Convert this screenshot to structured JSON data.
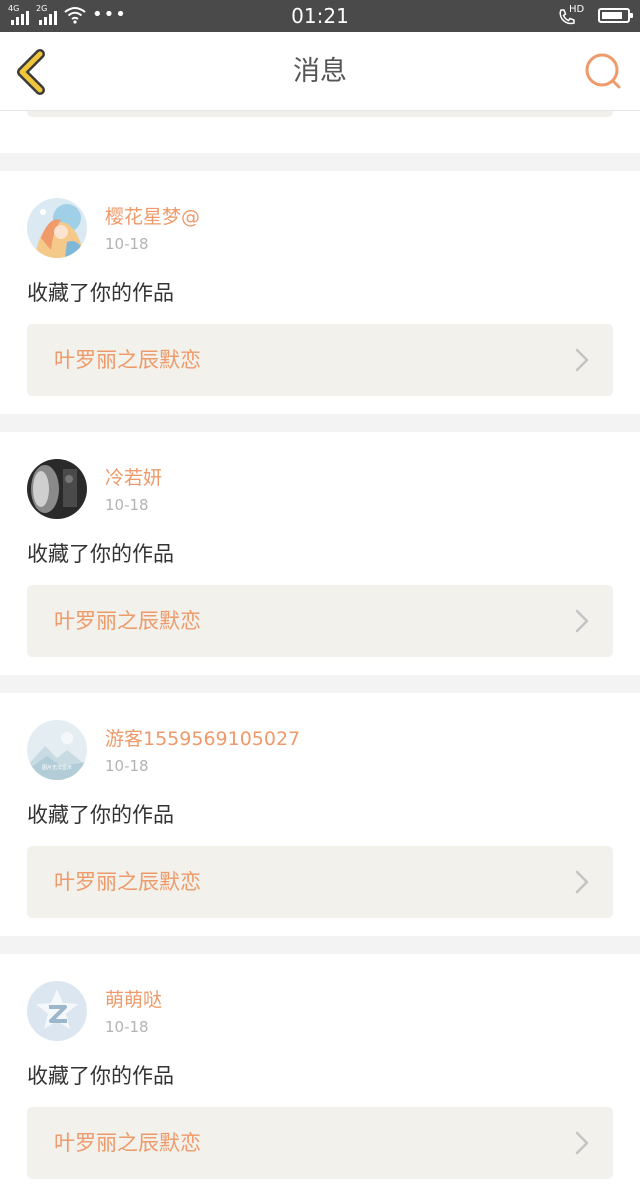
{
  "status_bar": {
    "sim1_label": "4G",
    "sim2_label": "2G",
    "time": "01:21",
    "call_label": "HD",
    "battery_level": 0.85
  },
  "header": {
    "title": "消息",
    "back_icon": "chevron-left-icon",
    "search_icon": "search-icon"
  },
  "colors": {
    "accent": "#ee9a6a",
    "back_icon": "#f0c63a",
    "card_bg": "#ffffff",
    "link_bg": "#f2f1ec",
    "page_bg": "#f3f3f3"
  },
  "messages": [
    {
      "user": "樱花星梦@",
      "date": "10-18",
      "action": "收藏了你的作品",
      "work": "叶罗丽之辰默恋",
      "avatar": "anime-girl-avatar"
    },
    {
      "user": "冷若妍",
      "date": "10-18",
      "action": "收藏了你的作品",
      "work": "叶罗丽之辰默恋",
      "avatar": "dark-photo-avatar"
    },
    {
      "user": "游客1559569105027",
      "date": "10-18",
      "action": "收藏了你的作品",
      "work": "叶罗丽之辰默恋",
      "avatar": "placeholder-image-avatar",
      "avatar_caption": "图片无法显示"
    },
    {
      "user": "萌萌哒",
      "date": "10-18",
      "action": "收藏了你的作品",
      "work": "叶罗丽之辰默恋",
      "avatar": "qq-default-avatar"
    }
  ]
}
